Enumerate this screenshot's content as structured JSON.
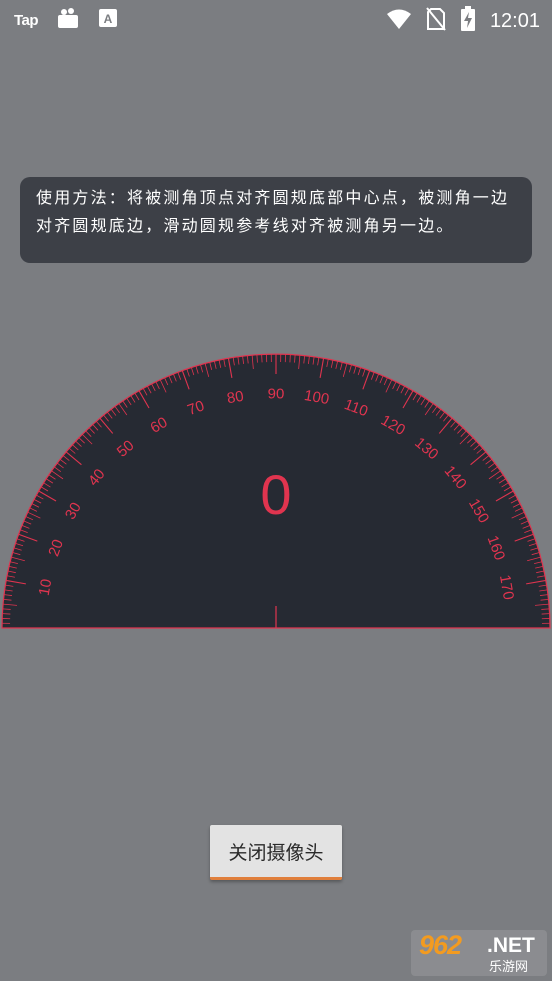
{
  "status_bar": {
    "left_label": "Tap",
    "notification_icons": [
      "bag-icon",
      "text-app-icon"
    ],
    "right_icons": [
      "wifi-icon",
      "no-sim-icon",
      "battery-charging-icon"
    ],
    "clock": "12:01"
  },
  "instruction": {
    "text": "使用方法：将被测角顶点对齐圆规底部中心点，被测角一边对齐圆规底边，滑动圆规参考线对齐被测角另一边。"
  },
  "protractor": {
    "angle_value": "0",
    "scale_labels": [
      "10",
      "20",
      "30",
      "40",
      "50",
      "60",
      "70",
      "80",
      "90",
      "100",
      "110",
      "120",
      "130",
      "140",
      "150",
      "160",
      "170"
    ],
    "accent_color": "#e0344f",
    "dial_color": "#262a33"
  },
  "buttons": {
    "close_camera": "关闭摄像头"
  },
  "watermark": {
    "brand_number": "962",
    "brand_suffix": ".NET",
    "brand_sub": "乐游网"
  }
}
